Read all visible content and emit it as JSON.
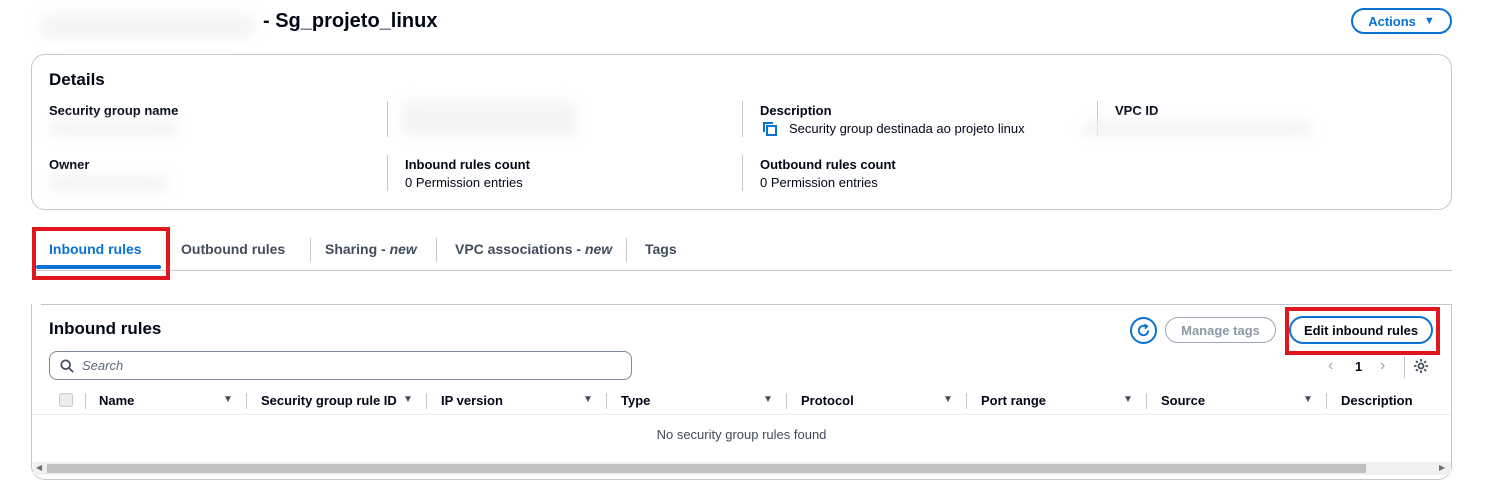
{
  "header": {
    "title": "- Sg_projeto_linux",
    "actions_label": "Actions"
  },
  "details": {
    "title": "Details",
    "sg_name_label": "Security group name",
    "description_label": "Description",
    "description_value": "Security group destinada ao projeto linux",
    "vpc_label": "VPC ID",
    "owner_label": "Owner",
    "inbound_count_label": "Inbound rules count",
    "inbound_count_value": "0 Permission entries",
    "outbound_count_label": "Outbound rules count",
    "outbound_count_value": "0 Permission entries"
  },
  "tabs": [
    {
      "label": "Inbound rules"
    },
    {
      "label": "Outbound rules"
    },
    {
      "label": "Sharing - ",
      "tag": "new"
    },
    {
      "label": "VPC associations - ",
      "tag": "new"
    },
    {
      "label": "Tags"
    }
  ],
  "rules": {
    "title": "Inbound rules",
    "manage_tags_label": "Manage tags",
    "edit_label": "Edit inbound rules",
    "search_placeholder": "Search",
    "page_number": "1",
    "columns": [
      "Name",
      "Security group rule ID",
      "IP version",
      "Type",
      "Protocol",
      "Port range",
      "Source",
      "Description"
    ],
    "empty_message": "No security group rules found"
  },
  "colors": {
    "accent": "#0972d3",
    "highlight_box": "#e0171f"
  },
  "icons": [
    "refresh-icon",
    "search-icon",
    "settings-icon",
    "copy-icon",
    "caret-down-icon",
    "chevron-left-icon",
    "chevron-right-icon"
  ]
}
